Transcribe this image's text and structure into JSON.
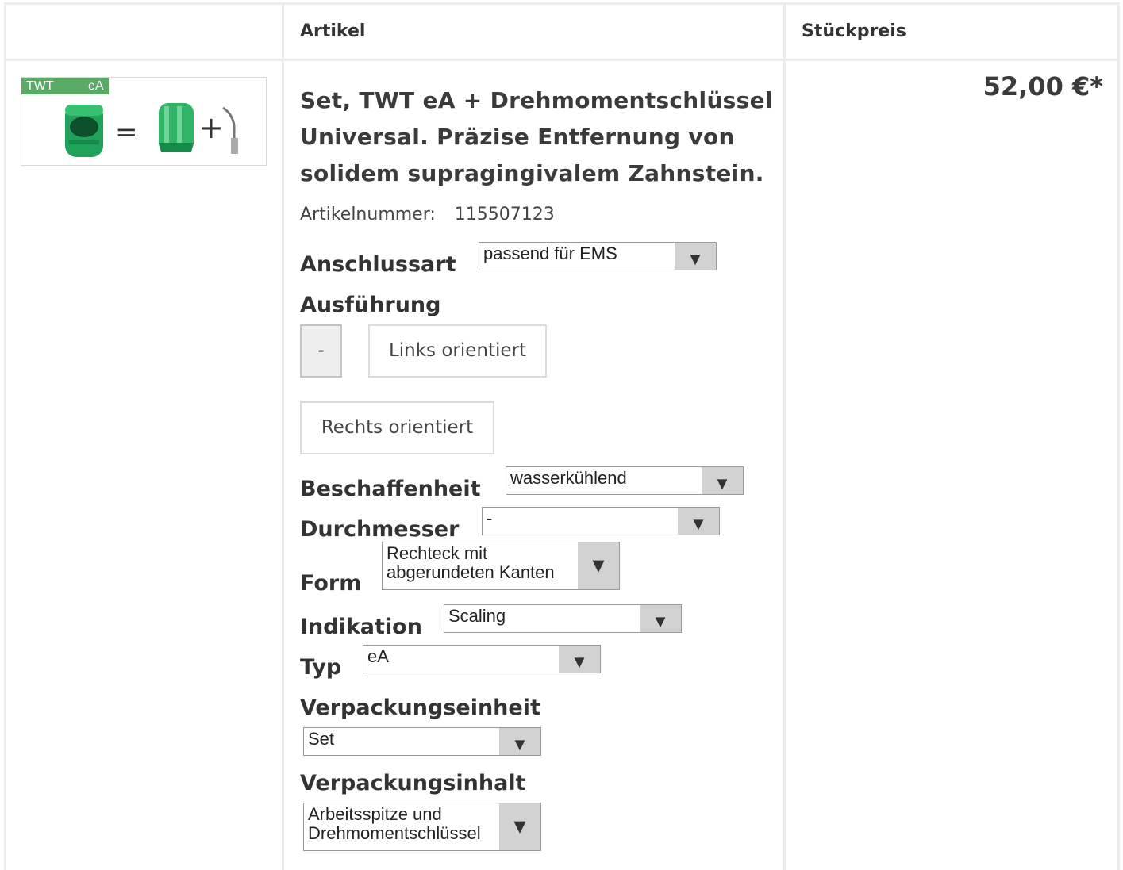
{
  "table": {
    "header_article": "Artikel",
    "header_unit_price": "Stückpreis"
  },
  "product": {
    "image_tag_left": "TWT",
    "image_tag_right": "eA",
    "image_eq": "=",
    "image_plus": "+",
    "title": "Set, TWT eA + Drehmomentschlüssel Universal. Präzise Entfernung von solidem supragingivalem Zahnstein.",
    "article_number_label": "Artikelnummer:",
    "article_number": "115507123",
    "price": "52,00 €*"
  },
  "options": {
    "connection": {
      "label": "Anschlussart",
      "value": "passend für EMS"
    },
    "version": {
      "label": "Ausführung",
      "buttons": [
        "-",
        "Links orientiert",
        "Rechts orientiert"
      ],
      "selected": "-"
    },
    "condition": {
      "label": "Beschaffenheit",
      "value": "wasserkühlend"
    },
    "diameter": {
      "label": "Durchmesser",
      "value": "-"
    },
    "form": {
      "label": "Form",
      "value": "Rechteck mit abgerundeten Kanten"
    },
    "indication": {
      "label": "Indikation",
      "value": "Scaling"
    },
    "type": {
      "label": "Typ",
      "value": "eA"
    },
    "packaging_unit": {
      "label": "Verpackungseinheit",
      "value": "Set"
    },
    "packaging_content": {
      "label": "Verpackungsinhalt",
      "value": "Arbeitsspitze und Drehmomentschlüssel"
    }
  },
  "icons": {
    "dropdown": "dropdown-arrow-icon",
    "arrow_glyph": "▼"
  },
  "colors": {
    "tag_green": "#5aaa66",
    "product_green": "#1fa35a",
    "grid": "#ececec"
  }
}
